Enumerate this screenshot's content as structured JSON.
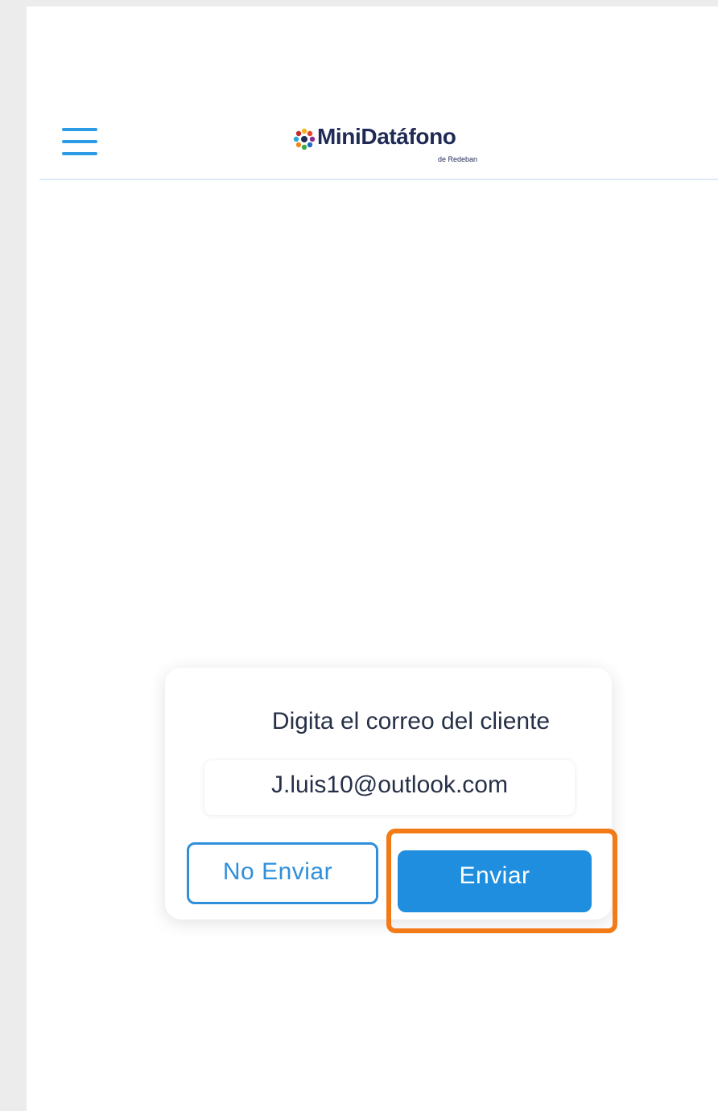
{
  "header": {
    "menu_icon": "hamburger-menu-icon",
    "logo_icon": "minidatafono-logo-icon",
    "logo_text": "MiniDatáfono",
    "logo_subtext": "de Redeban"
  },
  "dialog": {
    "title": "Digita el correo del cliente",
    "email_value": "J.luis10@outlook.com",
    "cancel_label": "No Enviar",
    "send_label": "Enviar"
  },
  "colors": {
    "accent": "#1f8ede",
    "highlight": "#f37b17",
    "brand_text": "#1f2a56"
  }
}
